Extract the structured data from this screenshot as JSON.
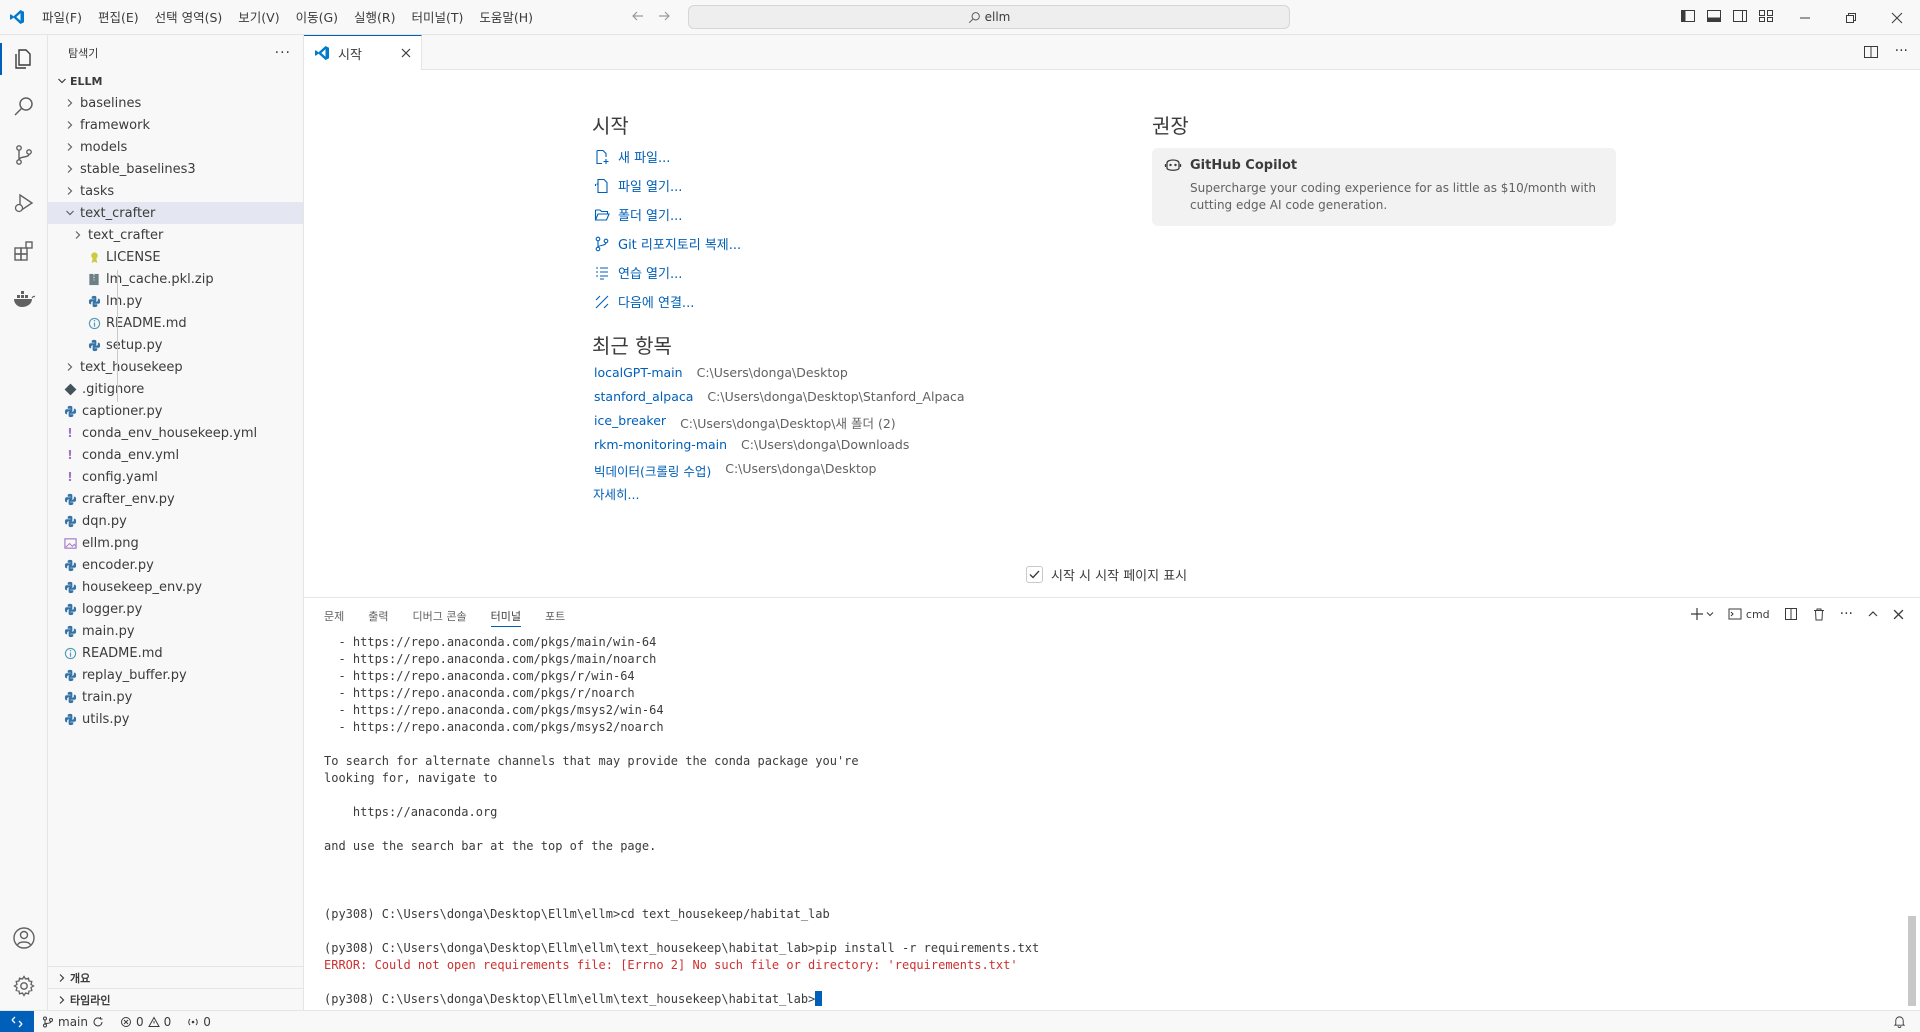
{
  "menu": [
    "파일(F)",
    "편집(E)",
    "선택 영역(S)",
    "보기(V)",
    "이동(G)",
    "실행(R)",
    "터미널(T)",
    "도움말(H)"
  ],
  "search": "ellm",
  "sidebar": {
    "title": "탐색기",
    "root": "ELLM",
    "items": [
      {
        "label": "baselines",
        "type": "folder",
        "level": 0,
        "expanded": false,
        "icon": "chevron-right"
      },
      {
        "label": "framework",
        "type": "folder",
        "level": 0,
        "expanded": false
      },
      {
        "label": "models",
        "type": "folder",
        "level": 0,
        "expanded": false
      },
      {
        "label": "stable_baselines3",
        "type": "folder",
        "level": 0,
        "expanded": false
      },
      {
        "label": "tasks",
        "type": "folder",
        "level": 0,
        "expanded": false
      },
      {
        "label": "text_crafter",
        "type": "folder",
        "level": 0,
        "expanded": true,
        "selected": true
      },
      {
        "label": "text_crafter",
        "type": "folder",
        "level": 1,
        "expanded": false
      },
      {
        "label": "LICENSE",
        "type": "license",
        "level": 1
      },
      {
        "label": "lm_cache.pkl.zip",
        "type": "zip",
        "level": 1
      },
      {
        "label": "lm.py",
        "type": "python",
        "level": 1
      },
      {
        "label": "README.md",
        "type": "info",
        "level": 1
      },
      {
        "label": "setup.py",
        "type": "python",
        "level": 1
      },
      {
        "label": "text_housekeep",
        "type": "folder",
        "level": 0,
        "expanded": false
      },
      {
        "label": ".gitignore",
        "type": "git",
        "level": 0
      },
      {
        "label": "captioner.py",
        "type": "python",
        "level": 0
      },
      {
        "label": "conda_env_housekeep.yml",
        "type": "yaml",
        "level": 0
      },
      {
        "label": "conda_env.yml",
        "type": "yaml",
        "level": 0
      },
      {
        "label": "config.yaml",
        "type": "yaml",
        "level": 0
      },
      {
        "label": "crafter_env.py",
        "type": "python",
        "level": 0
      },
      {
        "label": "dqn.py",
        "type": "python",
        "level": 0
      },
      {
        "label": "ellm.png",
        "type": "image",
        "level": 0
      },
      {
        "label": "encoder.py",
        "type": "python",
        "level": 0
      },
      {
        "label": "housekeep_env.py",
        "type": "python",
        "level": 0
      },
      {
        "label": "logger.py",
        "type": "python",
        "level": 0
      },
      {
        "label": "main.py",
        "type": "python",
        "level": 0
      },
      {
        "label": "README.md",
        "type": "info",
        "level": 0
      },
      {
        "label": "replay_buffer.py",
        "type": "python",
        "level": 0
      },
      {
        "label": "train.py",
        "type": "python",
        "level": 0
      },
      {
        "label": "utils.py",
        "type": "python",
        "level": 0
      }
    ],
    "outline": "개요",
    "timeline": "타임라인"
  },
  "tab": {
    "label": "시작"
  },
  "welcome": {
    "start_title": "시작",
    "start_items": [
      {
        "label": "새 파일...",
        "icon": "new-file-icon"
      },
      {
        "label": "파일 열기...",
        "icon": "open-file-icon"
      },
      {
        "label": "폴더 열기...",
        "icon": "open-folder-icon"
      },
      {
        "label": "Git 리포지토리 복제...",
        "icon": "git-clone-icon"
      },
      {
        "label": "연습 열기...",
        "icon": "walkthrough-icon"
      },
      {
        "label": "다음에 연결...",
        "icon": "remote-connect-icon"
      }
    ],
    "recent_title": "최근 항목",
    "recent": [
      {
        "name": "localGPT-main",
        "path": "C:\\Users\\donga\\Desktop"
      },
      {
        "name": "stanford_alpaca",
        "path": "C:\\Users\\donga\\Desktop\\Stanford_Alpaca"
      },
      {
        "name": "ice_breaker",
        "path": "C:\\Users\\donga\\Desktop\\새 폴더 (2)"
      },
      {
        "name": "rkm-monitoring-main",
        "path": "C:\\Users\\donga\\Downloads"
      },
      {
        "name": "빅데이터(크롤링 수업)",
        "path": "C:\\Users\\donga\\Desktop"
      }
    ],
    "more": "자세히...",
    "recommended_title": "권장",
    "copilot_title": "GitHub Copilot",
    "copilot_desc": "Supercharge your coding experience for as little as $10/month with cutting edge AI code generation.",
    "show_on_startup": "시작 시 시작 페이지 표시"
  },
  "panel": {
    "tabs": [
      "문제",
      "출력",
      "디버그 콘솔",
      "터미널",
      "포트"
    ],
    "active_tab": "터미널",
    "shell": "cmd"
  },
  "terminal": {
    "lines": [
      {
        "text": "  - https://repo.anaconda.com/pkgs/main/win-64",
        "err": false
      },
      {
        "text": "  - https://repo.anaconda.com/pkgs/main/noarch",
        "err": false
      },
      {
        "text": "  - https://repo.anaconda.com/pkgs/r/win-64",
        "err": false
      },
      {
        "text": "  - https://repo.anaconda.com/pkgs/r/noarch",
        "err": false
      },
      {
        "text": "  - https://repo.anaconda.com/pkgs/msys2/win-64",
        "err": false
      },
      {
        "text": "  - https://repo.anaconda.com/pkgs/msys2/noarch",
        "err": false
      },
      {
        "text": "",
        "err": false
      },
      {
        "text": "To search for alternate channels that may provide the conda package you're",
        "err": false
      },
      {
        "text": "looking for, navigate to",
        "err": false
      },
      {
        "text": "",
        "err": false
      },
      {
        "text": "    https://anaconda.org",
        "err": false
      },
      {
        "text": "",
        "err": false
      },
      {
        "text": "and use the search bar at the top of the page.",
        "err": false
      },
      {
        "text": "",
        "err": false
      },
      {
        "text": "",
        "err": false
      },
      {
        "text": "",
        "err": false
      },
      {
        "text": "(py308) C:\\Users\\donga\\Desktop\\Ellm\\ellm>cd text_housekeep/habitat_lab",
        "err": false
      },
      {
        "text": "",
        "err": false
      },
      {
        "text": "(py308) C:\\Users\\donga\\Desktop\\Ellm\\ellm\\text_housekeep\\habitat_lab>pip install -r requirements.txt",
        "err": false
      },
      {
        "text": "ERROR: Could not open requirements file: [Errno 2] No such file or directory: 'requirements.txt'",
        "err": true
      },
      {
        "text": "",
        "err": false
      }
    ],
    "prompt": "(py308) C:\\Users\\donga\\Desktop\\Ellm\\ellm\\text_housekeep\\habitat_lab>"
  },
  "status": {
    "branch": "main",
    "errors": "0",
    "warnings": "0",
    "ports": "0"
  },
  "colors": {
    "accent": "#005fb8",
    "error": "#cd3131"
  }
}
